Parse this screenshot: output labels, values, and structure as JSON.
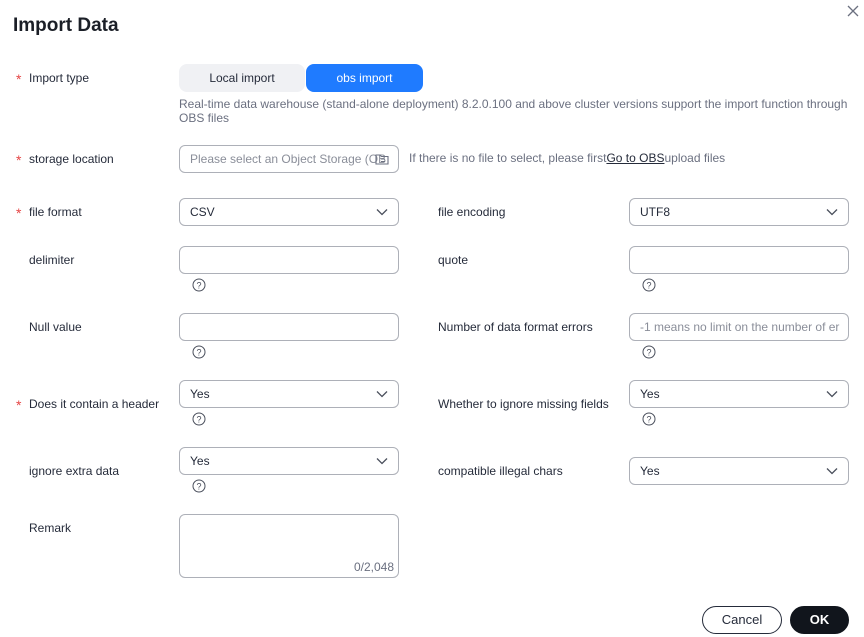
{
  "dialog": {
    "title": "Import Data",
    "ok_label": "OK",
    "cancel_label": "Cancel"
  },
  "import_type": {
    "label": "Import type",
    "options": [
      "Local import",
      "obs import"
    ],
    "selected": "obs import",
    "hint": "Real-time data warehouse (stand-alone deployment) 8.2.0.100 and above cluster versions support the import function through OBS files"
  },
  "storage_location": {
    "label": "storage location",
    "placeholder": "Please select an Object Storage (OB",
    "note_before": "If there is no file to select, please first",
    "link": "Go to OBS",
    "note_after": "upload files"
  },
  "file_format": {
    "label": "file format",
    "value": "CSV"
  },
  "file_encoding": {
    "label": "file encoding",
    "value": "UTF8"
  },
  "delimiter": {
    "label": "delimiter",
    "value": ""
  },
  "quote": {
    "label": "quote",
    "value": ""
  },
  "null_value": {
    "label": "Null value",
    "value": ""
  },
  "format_errors": {
    "label": "Number of data format errors",
    "placeholder": "-1 means no limit on the number of er"
  },
  "header": {
    "label": "Does it contain a header",
    "value": "Yes"
  },
  "ignore_missing": {
    "label": "Whether to ignore missing fields",
    "value": "Yes"
  },
  "ignore_extra": {
    "label": "ignore extra data",
    "value": "Yes"
  },
  "illegal_chars": {
    "label": "compatible illegal chars",
    "value": "Yes"
  },
  "remark": {
    "label": "Remark",
    "counter": "0/2,048"
  },
  "required_mark": "*",
  "colors": {
    "primary": "#1f7bff",
    "required": "#e54545",
    "dark_button": "#11151c"
  }
}
